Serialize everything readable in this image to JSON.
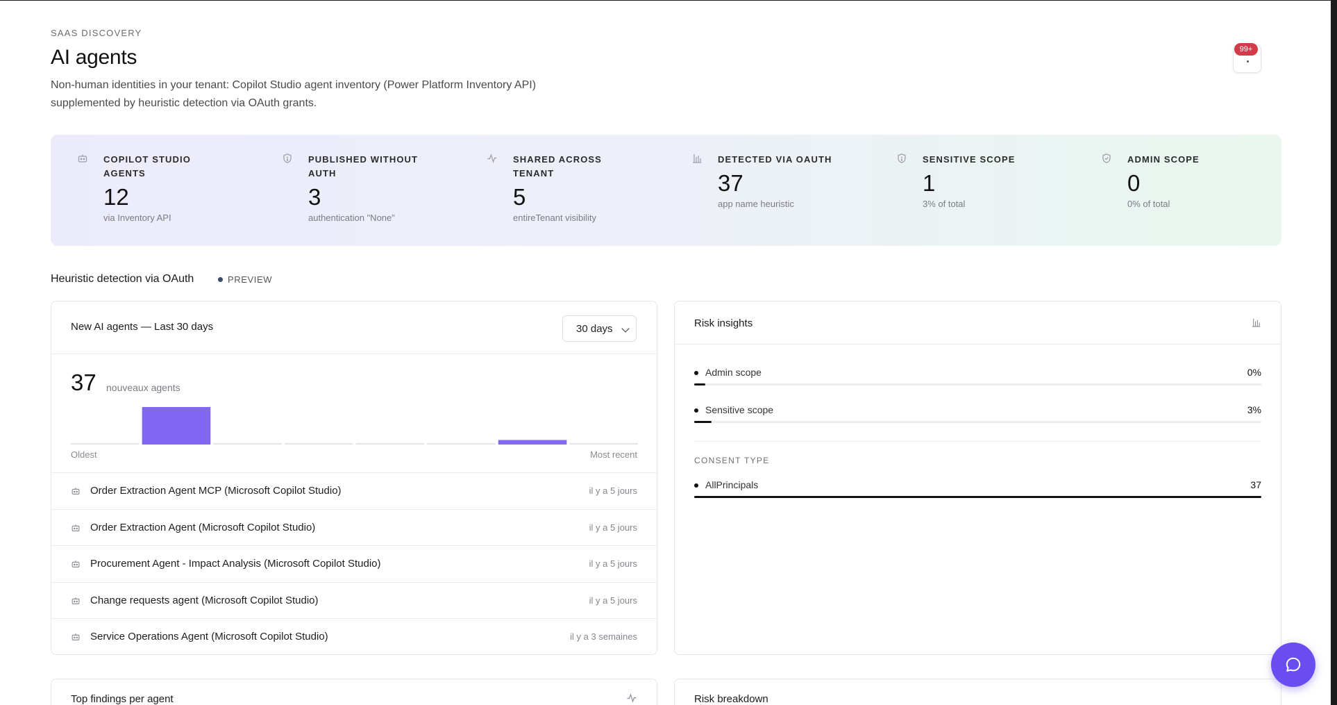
{
  "header": {
    "eyebrow": "SAAS DISCOVERY",
    "title": "AI agents",
    "description": "Non-human identities in your tenant: Copilot Studio agent inventory (Power Platform Inventory API) supplemented by heuristic detection via OAuth grants."
  },
  "notifications": {
    "badge": "99+",
    "icon": "bell-icon"
  },
  "stats": [
    {
      "label": "COPILOT STUDIO AGENTS",
      "value": "12",
      "sub": "via Inventory API",
      "icon": "bot-icon"
    },
    {
      "label": "PUBLISHED WITHOUT AUTH",
      "value": "3",
      "sub": "authentication \"None\"",
      "icon": "shield-icon"
    },
    {
      "label": "SHARED ACROSS TENANT",
      "value": "5",
      "sub": "entireTenant visibility",
      "icon": "activity-icon"
    },
    {
      "label": "DETECTED VIA OAUTH",
      "value": "37",
      "sub": "app name heuristic",
      "icon": "bar-chart-icon"
    },
    {
      "label": "SENSITIVE SCOPE",
      "value": "1",
      "sub": "3% of total",
      "icon": "shield-icon"
    },
    {
      "label": "ADMIN SCOPE",
      "value": "0",
      "sub": "0% of total",
      "icon": "shield-check-icon"
    }
  ],
  "section": {
    "title": "Heuristic detection via OAuth",
    "tag": "PREVIEW"
  },
  "new_agents": {
    "title": "New AI agents — Last 30 days",
    "range_select": "30 days",
    "count": "37",
    "count_label": "nouveaux agents",
    "axis_oldest": "Oldest",
    "axis_recent": "Most recent",
    "colors": {
      "bar": "#8267f2",
      "baseline": "#e4e4e8"
    },
    "chart_data": {
      "type": "bar",
      "categories": [
        "1",
        "2",
        "3",
        "4",
        "5",
        "6",
        "7",
        "8"
      ],
      "values": [
        0,
        33,
        0,
        0,
        0,
        0,
        4,
        0
      ],
      "xlabel": "",
      "ylabel": ""
    },
    "agents": [
      {
        "name": "Order Extraction Agent MCP (Microsoft Copilot Studio)",
        "time": "il y a 5 jours"
      },
      {
        "name": "Order Extraction Agent (Microsoft Copilot Studio)",
        "time": "il y a 5 jours"
      },
      {
        "name": "Procurement Agent - Impact Analysis (Microsoft Copilot Studio)",
        "time": "il y a 5 jours"
      },
      {
        "name": "Change requests agent (Microsoft Copilot Studio)",
        "time": "il y a 5 jours"
      },
      {
        "name": "Service Operations Agent (Microsoft Copilot Studio)",
        "time": "il y a 3 semaines"
      }
    ]
  },
  "risk_insights": {
    "title": "Risk insights",
    "admin_scope": {
      "label": "Admin scope",
      "value": "0%",
      "fraction": 0.0
    },
    "sensitive_scope": {
      "label": "Sensitive scope",
      "value": "3%",
      "fraction": 0.03
    },
    "consent_type_label": "CONSENT TYPE",
    "consent": {
      "label": "AllPrincipals",
      "value": "37",
      "fraction": 1.0
    }
  },
  "bottom_cards": {
    "top_findings": "Top findings per agent",
    "risk_breakdown": "Risk breakdown"
  },
  "chat": {
    "icon": "chat-bubble-icon"
  }
}
